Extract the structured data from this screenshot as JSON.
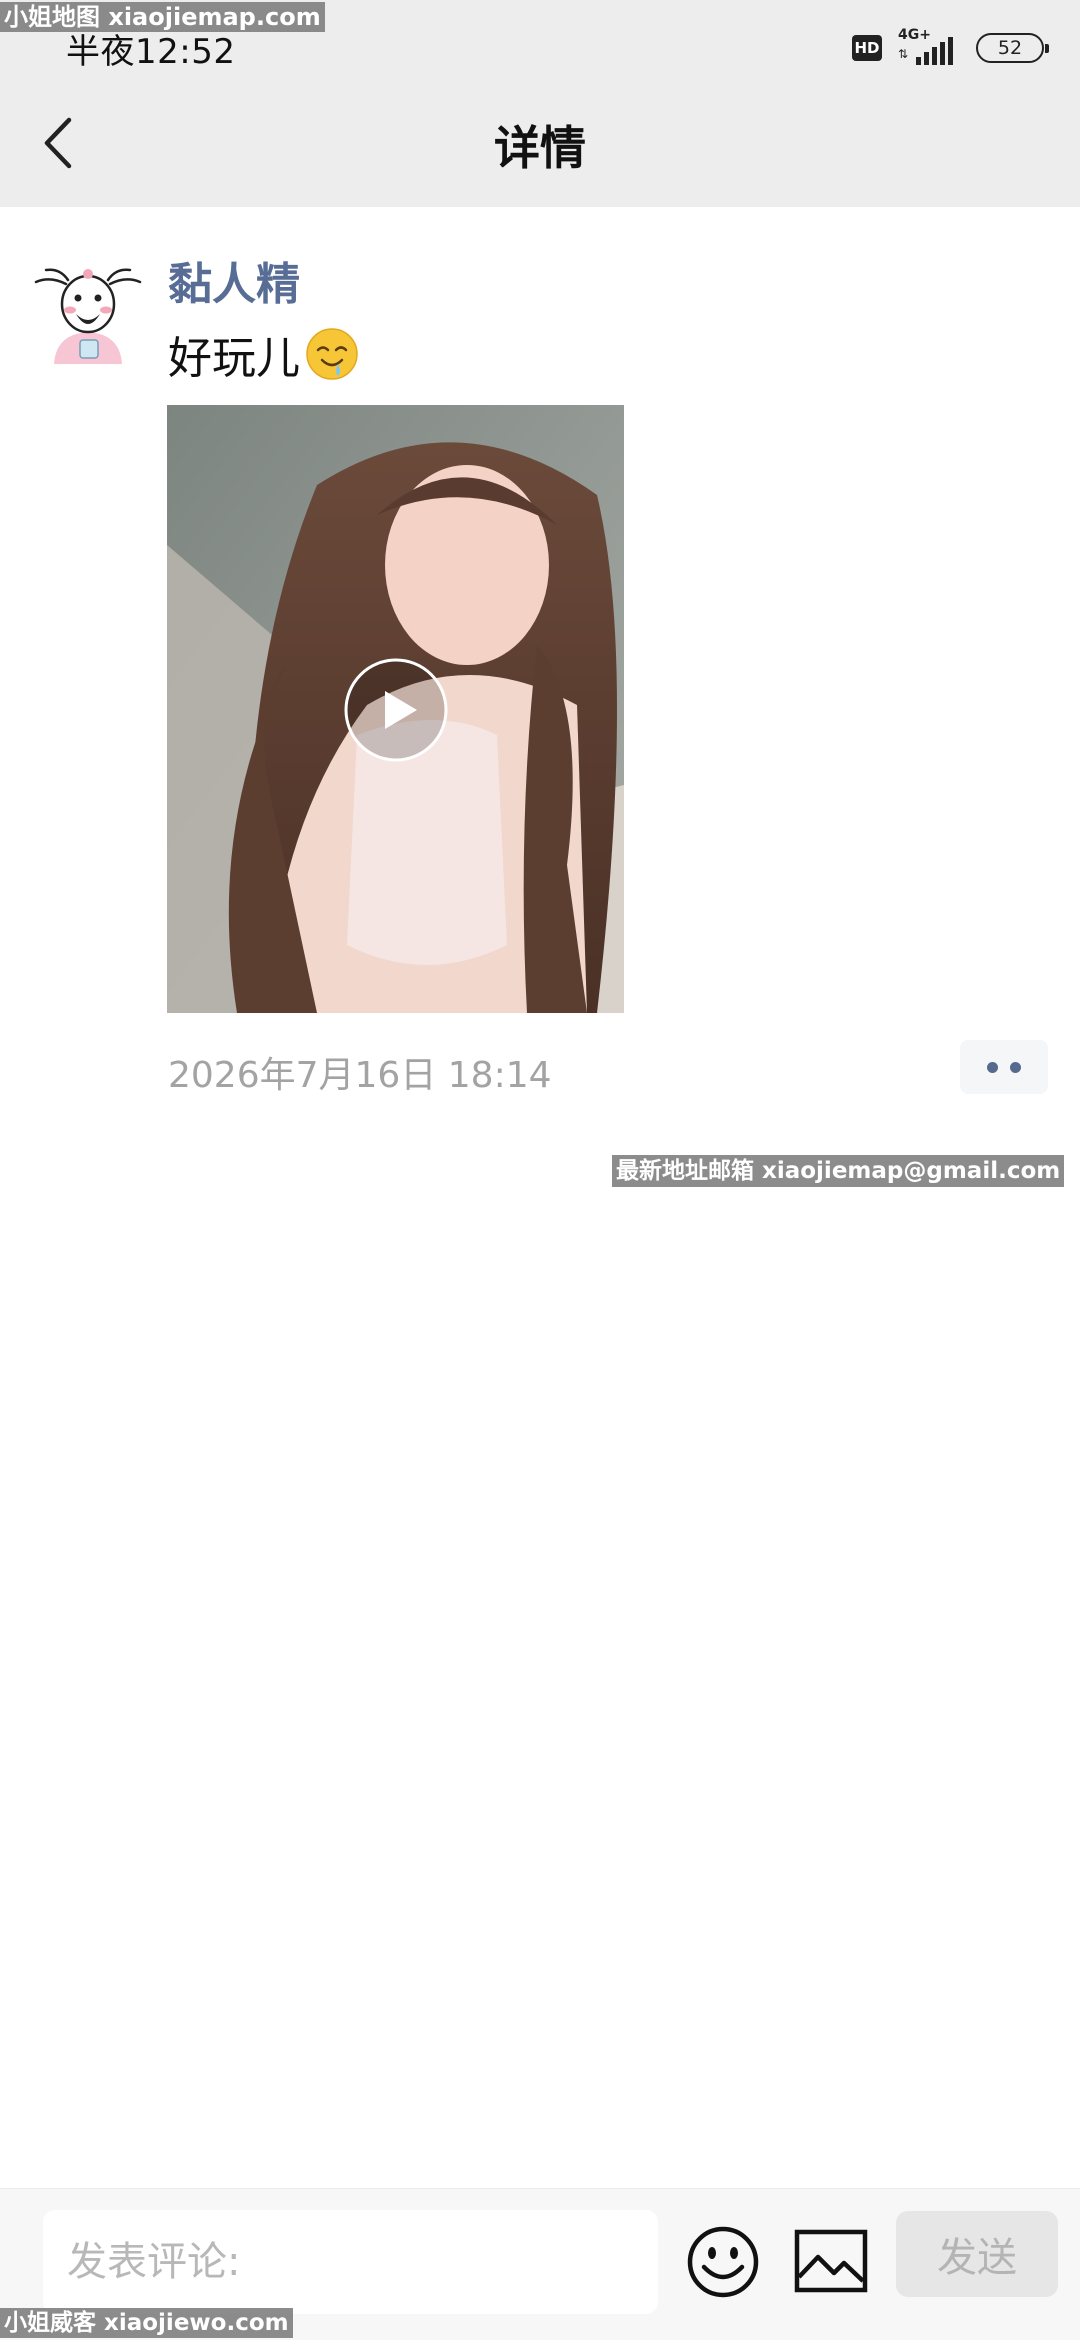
{
  "watermarks": {
    "top": "小姐地图 xiaojiemap.com",
    "middle": "最新地址邮箱 xiaojiemap@gmail.com",
    "bottom": "小姐威客 xiaojiewo.com"
  },
  "status_bar": {
    "time": "半夜12:52",
    "hd_badge": "HD",
    "network": "4G+",
    "network_arrows": "⇅",
    "battery": "52"
  },
  "header": {
    "title": "详情",
    "back_icon": "chevron-left-icon"
  },
  "post": {
    "username": "黏人精",
    "text": "好玩儿",
    "text_emoji": "drooling-face-icon",
    "media_type": "video",
    "timestamp": "2026年7月16日 18:14"
  },
  "comment_bar": {
    "placeholder": "发表评论:",
    "emoji_icon": "smiley-face-icon",
    "image_icon": "image-icon",
    "send_label": "发送"
  },
  "colors": {
    "header_bg": "#ededed",
    "username": "#586d95",
    "timestamp": "#a3a3a3",
    "more_dots": "#56698f",
    "send_disabled_bg": "#e6e6e6"
  }
}
